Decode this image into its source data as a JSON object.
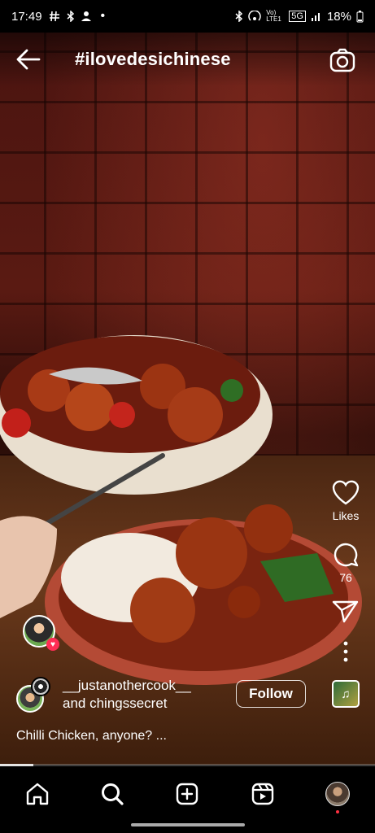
{
  "status_bar": {
    "time": "17:49",
    "left_icons": [
      "hashtag-notification-icon",
      "bluetooth-icon",
      "contacts-icon",
      "dot-icon"
    ],
    "right_icons": [
      "bluetooth-icon",
      "hotspot-icon",
      "volte-icon",
      "5g-icon",
      "signal-icon"
    ],
    "network_label": "5G",
    "volte_label": "Vo) LTE1",
    "battery": "18%"
  },
  "header": {
    "title": "#ilovedesichinese",
    "back_icon": "arrow-left-icon",
    "camera_icon": "camera-icon"
  },
  "actions": {
    "like_label": "Likes",
    "comment_count": "76",
    "share_icon": "paper-plane-icon",
    "more_icon": "more-vertical-icon",
    "audio_icon": "music-note-icon"
  },
  "post": {
    "author_line1": "__justanothercook__",
    "author_line2": "and chingssecret",
    "follow_label": "Follow",
    "caption": "Chilli Chicken, anyone? ..."
  },
  "progress": 0.09,
  "nav": {
    "items": [
      "home-icon",
      "search-icon",
      "add-post-icon",
      "reels-icon",
      "profile-avatar"
    ]
  }
}
